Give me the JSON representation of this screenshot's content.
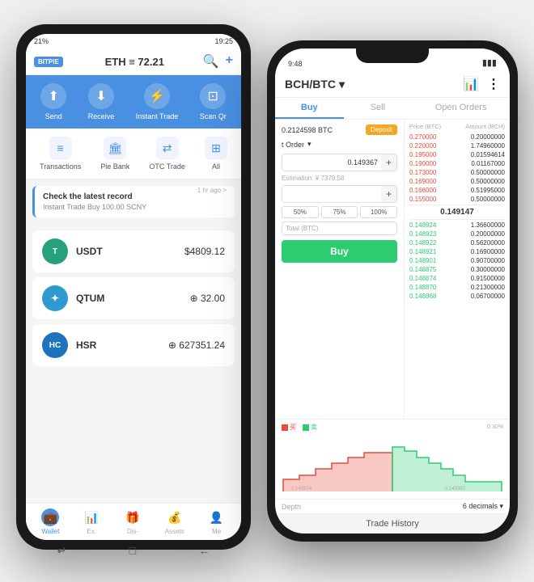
{
  "scene": {
    "background": "#f0f0f0"
  },
  "android": {
    "status_bar": {
      "signal": "21%",
      "time": "19:25"
    },
    "header": {
      "logo": "BITPIE",
      "currency": "ETH",
      "balance": "72.21",
      "search_icon": "🔍",
      "plus_icon": "+"
    },
    "actions": [
      {
        "label": "Send",
        "icon": "↑"
      },
      {
        "label": "Receive",
        "icon": "↓"
      },
      {
        "label": "Instant Trade",
        "icon": "⚡"
      },
      {
        "label": "Scan Qr",
        "icon": "⊡"
      }
    ],
    "secondary": [
      {
        "label": "Transactions",
        "icon": "≡"
      },
      {
        "label": "Pie Bank",
        "icon": "🏛"
      },
      {
        "label": "OTC Trade",
        "icon": "⇄"
      },
      {
        "label": "All",
        "icon": "⊞"
      }
    ],
    "notification": {
      "title": "Check the latest record",
      "subtitle": "Instant Trade Buy 100.00 SCNY",
      "time": "1 hr ago >"
    },
    "wallets": [
      {
        "name": "USDT",
        "balance": "$4809.12",
        "icon": "T",
        "color": "#26a17b"
      },
      {
        "name": "QTUM",
        "balance": "⊕ 32.00",
        "icon": "Q",
        "color": "#2e9ad0"
      },
      {
        "name": "HSR",
        "balance": "⊕ 627351.24",
        "icon": "H",
        "color": "#1e73be"
      }
    ],
    "nav_tabs": [
      {
        "label": "Wallet",
        "icon": "💼",
        "active": true
      },
      {
        "label": "Ex.",
        "icon": "📊",
        "active": false
      },
      {
        "label": "Dis-",
        "icon": "🎁",
        "active": false
      },
      {
        "label": "Assets",
        "icon": "💰",
        "active": false
      },
      {
        "label": "Me",
        "icon": "👤",
        "active": false
      }
    ],
    "bottom_nav": [
      "↵",
      "□",
      "←"
    ]
  },
  "iphone": {
    "status_bar": {
      "time": "9:48",
      "battery": "●"
    },
    "header": {
      "pair": "BCH/BTC",
      "dropdown": "▾",
      "chart_icon": "📊",
      "more_icon": "⋮"
    },
    "tabs": [
      {
        "label": "Buy",
        "active": true
      },
      {
        "label": "Sell",
        "active": false
      },
      {
        "label": "Open Orders",
        "active": false
      }
    ],
    "order_form": {
      "balance": "0.2124598 BTC",
      "deposit_label": "Deposit",
      "order_type": "Limit Order",
      "price_label": "Price (BTC)",
      "price_value": "0.149367",
      "estimation": "Estimation: ¥ 7379.58",
      "amount_label": "Amount (BCH)",
      "pct_options": [
        "50%",
        "75%",
        "100%"
      ],
      "total_label": "Total (BTC)",
      "buy_label": "Buy"
    },
    "order_book": {
      "headers": [
        "Price (BTC)",
        "Amount (BCH)"
      ],
      "sell_orders": [
        {
          "price": "0.270000",
          "amount": "0.20000000"
        },
        {
          "price": "0.220000",
          "amount": "1.74960000"
        },
        {
          "price": "0.195000",
          "amount": "0.01594614"
        },
        {
          "price": "0.190000",
          "amount": "0.01167000"
        },
        {
          "price": "0.173000",
          "amount": "0.50000000"
        },
        {
          "price": "0.169000",
          "amount": "0.50000000"
        },
        {
          "price": "0.166000",
          "amount": "0.51995000"
        },
        {
          "price": "0.155000",
          "amount": "0.50000000"
        }
      ],
      "mid_price": "0.149147",
      "buy_orders": [
        {
          "price": "0.148924",
          "amount": "1.36600000"
        },
        {
          "price": "0.148923",
          "amount": "0.20000000"
        },
        {
          "price": "0.148922",
          "amount": "0.56200000"
        },
        {
          "price": "0.148921",
          "amount": "0.16900000"
        },
        {
          "price": "0.148901",
          "amount": "0.90700000"
        },
        {
          "price": "0.148875",
          "amount": "0.30000000"
        },
        {
          "price": "0.148874",
          "amount": "0.91500000"
        },
        {
          "price": "0.148870",
          "amount": "0.21300000"
        },
        {
          "price": "0.148868",
          "amount": "0.06700000"
        }
      ]
    },
    "chart": {
      "legend_buy": "买",
      "legend_sell": "卖",
      "pct": "0.30%"
    },
    "depth_footer": {
      "label": "Depth",
      "decimals": "6 decimals",
      "dropdown": "▾"
    },
    "trade_history": "Trade History"
  }
}
